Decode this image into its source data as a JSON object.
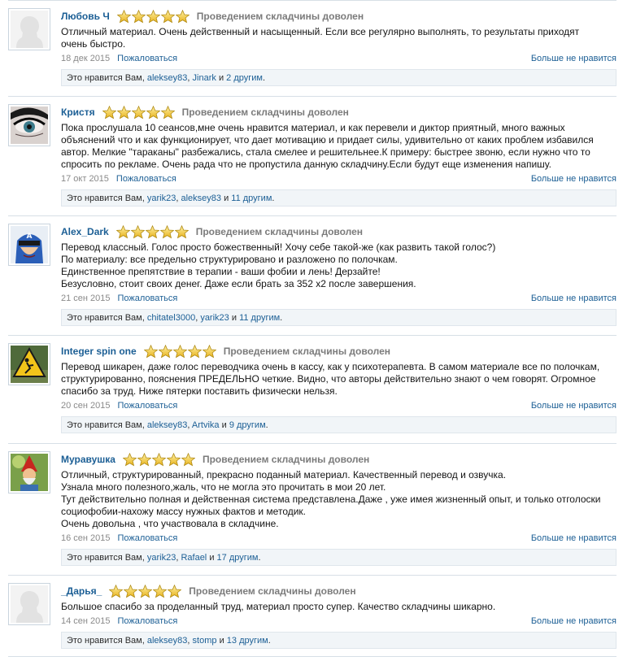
{
  "reviews": [
    {
      "author": "Любовь Ч",
      "avatar_icon": "default-user-silhouette-icon",
      "rating": 5,
      "verdict": "Проведением складчины доволен",
      "text_lines": [
        "Отличный материал. Очень действенный и насыщенный. Если все регулярно выполнять, то результаты приходят",
        "очень быстро."
      ],
      "date": "18 дек 2015",
      "report": "Пожаловаться",
      "unlike": "Больше не нравится",
      "likes_prefix": "Это нравится Вам,",
      "likers": [
        "aleksey83",
        "Jinark"
      ],
      "likes_and": "и",
      "others": "2 другим",
      "likes_end": "."
    },
    {
      "author": "Кристя",
      "avatar_icon": "eye-makeup-photo-icon",
      "rating": 5,
      "verdict": "Проведением складчины доволен",
      "text_lines": [
        "Пока прослушала 10 сеансов,мне очень нравится материал, и как перевели и диктор приятный, много важных",
        "объяснений что и как функционирует, что дает мотивацию и придает силы, удивительно от каких проблем избавился",
        "автор. Мелкие \"тараканы\" разбежались, стала смелее и решительнее.К примеру: быстрее звоню, если нужно что то",
        "спросить по рекламе. Очень рада что не пропустила данную складчину.Если будут еще изменения напишу."
      ],
      "date": "17 окт 2015",
      "report": "Пожаловаться",
      "unlike": "Больше не нравится",
      "likes_prefix": "Это нравится Вам,",
      "likers": [
        "yarik23",
        "aleksey83"
      ],
      "likes_and": "и",
      "others": "11 другим",
      "likes_end": "."
    },
    {
      "author": "Alex_Dark",
      "avatar_icon": "captain-america-cartoon-icon",
      "rating": 5,
      "verdict": "Проведением складчины доволен",
      "text_lines": [
        "Перевод классный. Голос просто божественный! Хочу себе такой-же (как развить такой голос?)",
        "По материалу: все предельно структурировано и разложено по полочкам.",
        "Единственное препятствие в терапии - ваши фобии и лень! Дерзайте!",
        "Безусловно, стоит своих денег. Даже если брать за 352 x2 после завершения."
      ],
      "date": "21 сен 2015",
      "report": "Пожаловаться",
      "unlike": "Больше не нравится",
      "likes_prefix": "Это нравится Вам,",
      "likers": [
        "chitatel3000",
        "yarik23"
      ],
      "likes_and": "и",
      "others": "11 другим",
      "likes_end": "."
    },
    {
      "author": "Integer spin one",
      "avatar_icon": "warning-sign-icon",
      "rating": 5,
      "verdict": "Проведением складчины доволен",
      "text_lines": [
        "Перевод шикарен, даже голос переводчика очень в кассу, как у психотерапевта. В самом материале все по полочкам,",
        "структурированно, пояснения ПРЕДЕЛЬНО четкие. Видно, что авторы действительно знают о чем говорят. Огромное",
        "спасибо за труд. Ниже пятерки поставить физически нельзя."
      ],
      "date": "20 сен 2015",
      "report": "Пожаловаться",
      "unlike": "Больше не нравится",
      "likes_prefix": "Это нравится Вам,",
      "likers": [
        "aleksey83",
        "Artvika"
      ],
      "likes_and": "и",
      "others": "9 другим",
      "likes_end": "."
    },
    {
      "author": "Муравушка",
      "avatar_icon": "gnome-picture-icon",
      "rating": 5,
      "verdict": "Проведением складчины доволен",
      "text_lines": [
        "Отличный, структурированный, прекрасно поданный материал. Качественный перевод и озвучка.",
        "Узнала много полезного,жаль, что не могла это прочитать в мои 20 лет.",
        "Тут действительно полная и действенная система представлена.Даже , уже имея жизненный опыт, и только отголоски",
        "социофобии-нахожу массу нужных фактов и методик.",
        "Очень довольна , что участвовала в складчине."
      ],
      "date": "16 сен 2015",
      "report": "Пожаловаться",
      "unlike": "Больше не нравится",
      "likes_prefix": "Это нравится Вам,",
      "likers": [
        "yarik23",
        "Rafael"
      ],
      "likes_and": "и",
      "others": "17 другим",
      "likes_end": "."
    },
    {
      "author": "_Дарья_",
      "avatar_icon": "default-user-silhouette-icon",
      "rating": 5,
      "verdict": "Проведением складчины доволен",
      "text_lines": [
        "Большое спасибо за проделанный труд, материал просто супер. Качество складчины шикарно."
      ],
      "date": "14 сен 2015",
      "report": "Пожаловаться",
      "unlike": "Больше не нравится",
      "likes_prefix": "Это нравится Вам,",
      "likers": [
        "aleksey83",
        "stomp"
      ],
      "likes_and": "и",
      "others": "13 другим",
      "likes_end": "."
    }
  ],
  "colors": {
    "link": "#1c5f95",
    "verdict": "#7b7b7b",
    "date": "#8a8a8a",
    "star_fill": "#f7d63a",
    "likes_bg": "#f1f5f8",
    "divider": "#d7dfe6"
  }
}
